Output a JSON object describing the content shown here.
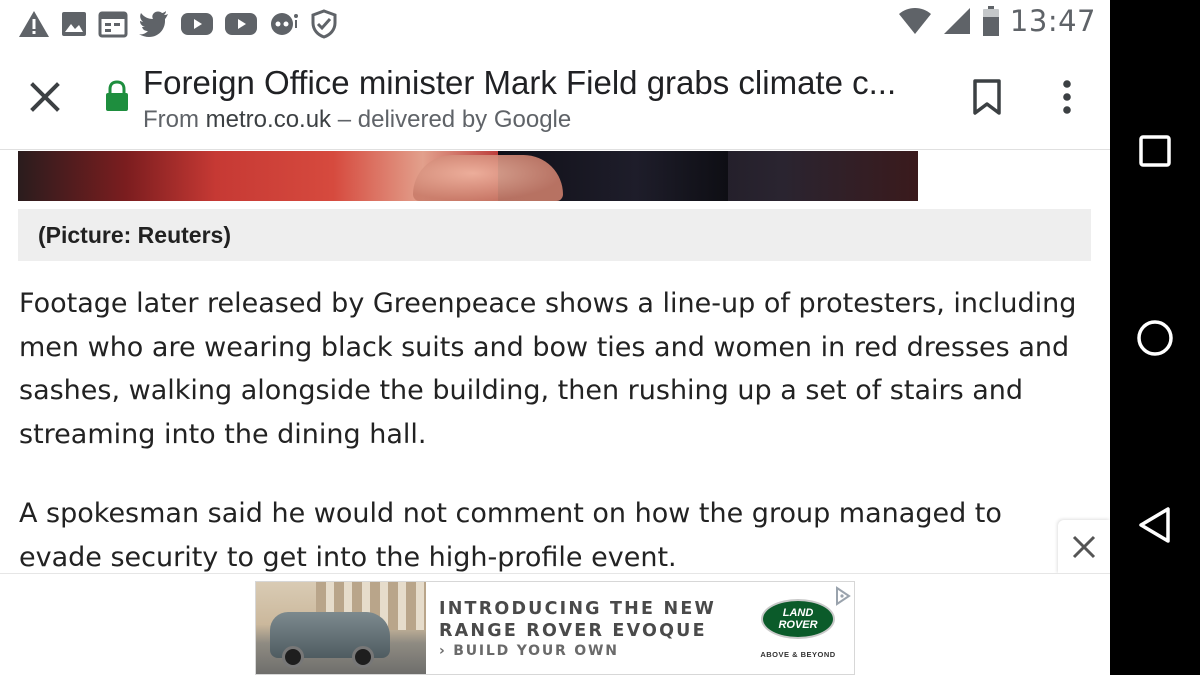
{
  "status_bar": {
    "time": "13:47",
    "left_icons": [
      "warning-icon",
      "image-icon",
      "calendar-icon",
      "twitter-icon",
      "youtube-icon",
      "youtube-icon",
      "speech-icon",
      "shield-check-icon"
    ],
    "right_icons": [
      "wifi-icon",
      "cell-signal-icon",
      "battery-icon"
    ]
  },
  "app_bar": {
    "title": "Foreign Office minister Mark Field grabs climate c...",
    "subtitle_prefix": "From",
    "domain": "metro.co.uk",
    "subtitle_suffix": "– delivered by Google",
    "secure_color": "#1e8e3e"
  },
  "article": {
    "caption": "(Picture: Reuters)",
    "paragraph_1": "Footage later released by Greenpeace shows a line-up of protesters, including men who are wearing black suits and bow ties and women in red dresses and sashes, walking alongside the building, then rushing up a set of stairs and streaming into the dining hall.",
    "paragraph_2": "A spokesman said he would not comment on how the group managed to evade security to get into the high-profile event."
  },
  "ad": {
    "headline_line_1": "INTRODUCING THE NEW",
    "headline_line_2": "RANGE ROVER EVOQUE",
    "cta": "› BUILD YOUR OWN",
    "logo_text_1": "LAND",
    "logo_text_2": "ROVER",
    "tagline": "ABOVE & BEYOND",
    "logo_color": "#0b5b2a"
  },
  "nav_bar": {
    "buttons": [
      "recents-square-icon",
      "home-circle-icon",
      "back-triangle-icon"
    ]
  }
}
